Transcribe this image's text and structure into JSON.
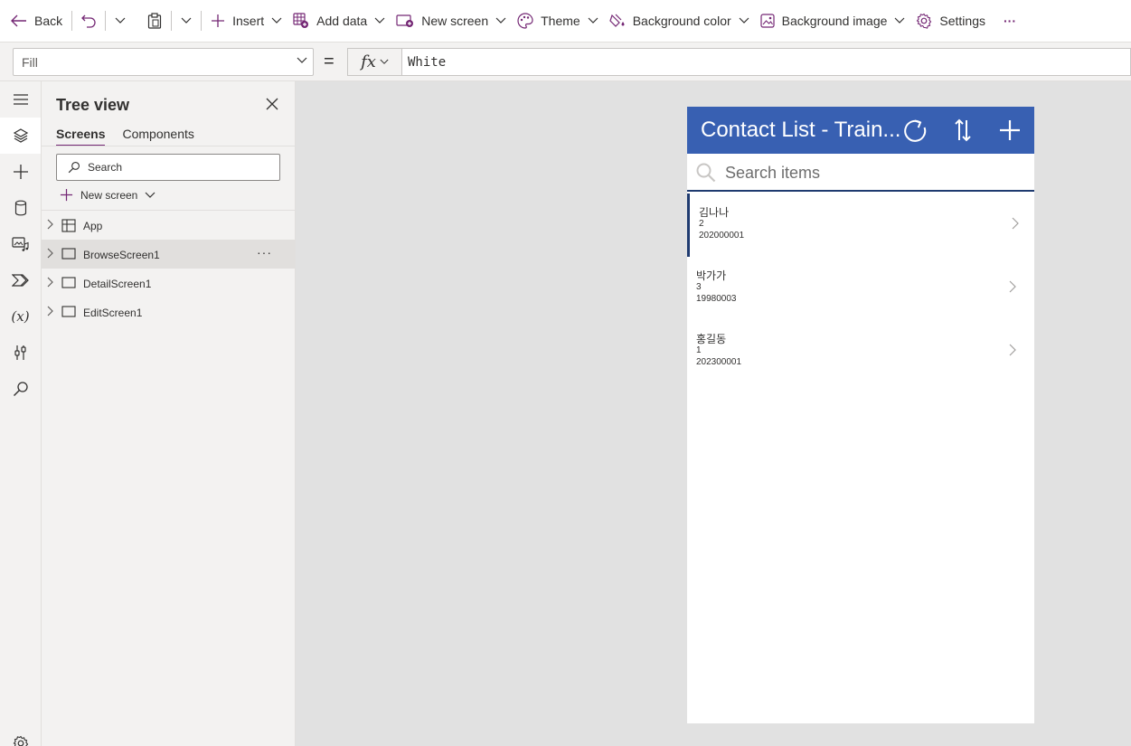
{
  "toolbar": {
    "back_label": "Back",
    "insert_label": "Insert",
    "add_data_label": "Add data",
    "new_screen_label": "New screen",
    "theme_label": "Theme",
    "background_color_label": "Background color",
    "background_image_label": "Background image",
    "settings_label": "Settings",
    "more_label": "···"
  },
  "formula_bar": {
    "property": "Fill",
    "equals": "=",
    "fx_label": "fx",
    "formula": "White"
  },
  "rail": {
    "icons": [
      "hamburger-icon",
      "layers-icon",
      "plus-icon",
      "database-icon",
      "media-icon",
      "automate-icon",
      "variables-icon",
      "tools-icon",
      "search-icon",
      "settings-icon"
    ],
    "variables_glyph": "(x)"
  },
  "tree": {
    "title": "Tree view",
    "tabs": [
      "Screens",
      "Components"
    ],
    "search_placeholder": "Search",
    "new_screen_label": "New screen",
    "items": [
      {
        "label": "App"
      },
      {
        "label": "BrowseScreen1",
        "more": "···"
      },
      {
        "label": "DetailScreen1"
      },
      {
        "label": "EditScreen1"
      }
    ]
  },
  "app": {
    "title": "Contact List - Train...",
    "search_placeholder": "Search items",
    "records": [
      {
        "name": "김나나",
        "value": "2",
        "id": "202000001"
      },
      {
        "name": "박가가",
        "value": "3",
        "id": "19980003"
      },
      {
        "name": "홍길동",
        "value": "1",
        "id": "202300001"
      }
    ]
  },
  "colors": {
    "accent": "#742774",
    "app_header": "#3860b2",
    "selection_border": "#1f3b70"
  }
}
